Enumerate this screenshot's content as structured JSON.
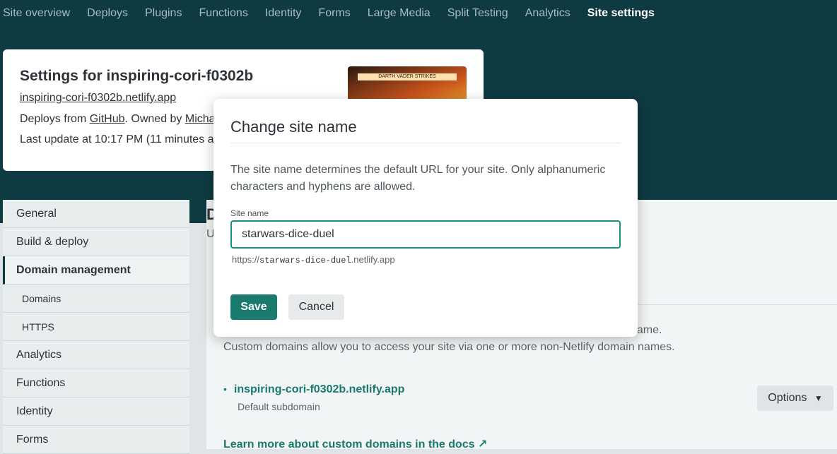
{
  "nav": {
    "items": [
      "Site overview",
      "Deploys",
      "Plugins",
      "Functions",
      "Identity",
      "Forms",
      "Large Media",
      "Split Testing",
      "Analytics",
      "Site settings"
    ],
    "active": "Site settings"
  },
  "card": {
    "title": "Settings for inspiring-cori-f0302b",
    "url": "inspiring-cori-f0302b.netlify.app",
    "deploys_prefix": "Deploys from ",
    "deploys_source": "GitHub",
    "owned_prefix": ". Owned by ",
    "owner": "Micha",
    "last_update": "Last update at 10:17 PM (11 minutes ag",
    "thumbnail_text": "DARTH VADER STRIKES"
  },
  "sidebar": {
    "items": [
      {
        "label": "General"
      },
      {
        "label": "Build & deploy"
      },
      {
        "label": "Domain management"
      },
      {
        "label": "Domains"
      },
      {
        "label": "HTTPS"
      },
      {
        "label": "Analytics"
      },
      {
        "label": "Functions"
      },
      {
        "label": "Identity"
      },
      {
        "label": "Forms"
      }
    ]
  },
  "main": {
    "heading": "D",
    "sub": "U",
    "desc_line1_tail": "name.",
    "desc_line2": "Custom domains allow you to access your site via one or more non-Netlify domain names.",
    "domain": "inspiring-cori-f0302b.netlify.app",
    "domain_sub": "Default subdomain",
    "options_label": "Options",
    "learn_link": "Learn more about custom domains in the docs ↗"
  },
  "modal": {
    "title": "Change site name",
    "description": "The site name determines the default URL for your site. Only alphanumeric characters and hyphens are allowed.",
    "field_label": "Site name",
    "field_value": "starwars-dice-duel",
    "url_prefix": "https://",
    "url_name": "starwars-dice-duel",
    "url_suffix": ".netlify.app",
    "save_label": "Save",
    "cancel_label": "Cancel"
  },
  "colors": {
    "nav_bg": "#0e3a41",
    "accent": "#1a7a6d",
    "page_bg": "#dfe5e6"
  }
}
